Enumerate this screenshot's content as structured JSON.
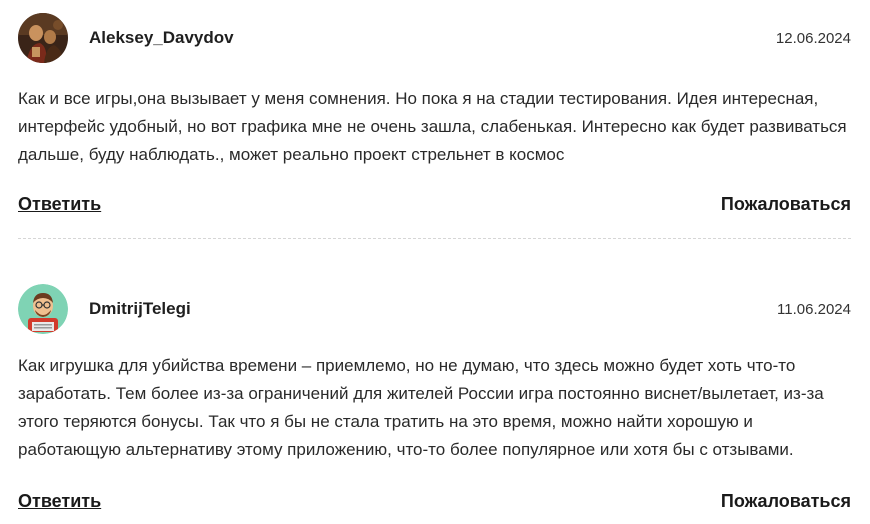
{
  "comments": [
    {
      "author": "Aleksey_Davydov",
      "date": "12.06.2024",
      "text": "Как и все игры,она вызывает у меня сомнения. Но пока я на стадии тестирования. Идея интересная, интерфейс удобный, но вот графика мне не очень зашла, слабенькая. Интересно как будет развиваться дальше, буду наблюдать., может реально проект стрельнет в космос",
      "reply_label": "Ответить",
      "report_label": "Пожаловаться",
      "avatar_icon": "painting-avatar-icon"
    },
    {
      "author": "DmitrijTelegi",
      "date": "11.06.2024",
      "text": "Как игрушка для убийства времени – приемлемо, но не думаю, что здесь можно будет хоть что-то заработать. Тем более из-за ограничений для жителей России игра постоянно виснет/вылетает, из-за этого теряются бонусы. Так что я бы не стала тратить на это время, можно найти хорошую и работающую альтернативу этому приложению, что-то более популярное или хотя бы с отзывами.",
      "reply_label": "Ответить",
      "report_label": "Пожаловаться",
      "avatar_icon": "cartoon-man-avatar-icon"
    }
  ],
  "colors": {
    "text": "#2a2a2a",
    "divider": "#d6d6d6",
    "avatar2_bg": "#7fd3b4"
  }
}
